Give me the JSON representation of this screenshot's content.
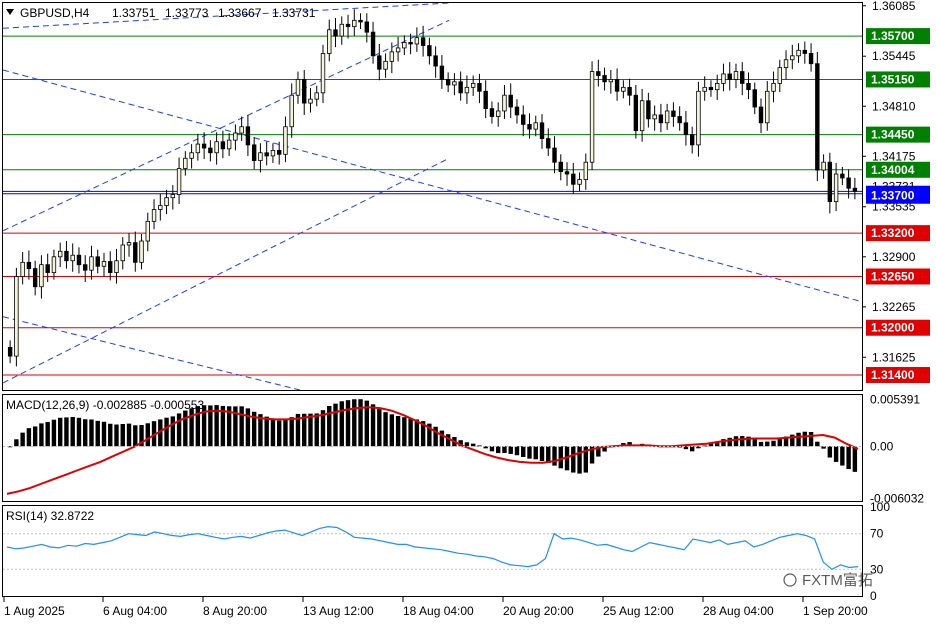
{
  "header": {
    "symbol": "GBPUSD,H4",
    "ohlc": [
      "1.33751",
      "1.33773",
      "1.33667",
      "1.33731"
    ],
    "collapse_icon": "triangle-down-icon"
  },
  "colors": {
    "background": "#ffffff",
    "bull_candle": "#f5f5dc",
    "bear_candle": "#000000",
    "green_line": "#008000",
    "red_line": "#e00000",
    "blue_line": "#0000ff",
    "channel": "#1e3cff",
    "macd_signal": "#e00000",
    "rsi_line": "#1e90ff",
    "green_tag": "#008000",
    "red_tag": "#e00000",
    "blue_tag": "#0000ff"
  },
  "chart_data": [
    {
      "type": "candlestick",
      "title": "GBPUSD,H4",
      "y_axis_labels": [
        "1.36085",
        "1.35445",
        "1.34810",
        "1.34175",
        "1.33535",
        "1.32900",
        "1.32265",
        "1.31625"
      ],
      "ylim": [
        1.3121,
        1.3612
      ],
      "x_tick_labels": [
        "1 Aug 2025",
        "6 Aug 04:00",
        "8 Aug 20:00",
        "13 Aug 12:00",
        "18 Aug 04:00",
        "20 Aug 20:00",
        "25 Aug 12:00",
        "28 Aug 04:00",
        "1 Sep 20:00"
      ],
      "levels": [
        {
          "value": 1.357,
          "label": "1.35700",
          "kind": "resistance"
        },
        {
          "value": 1.3515,
          "label": "1.35150",
          "kind": "resistance"
        },
        {
          "value": 1.3445,
          "label": "1.34450",
          "kind": "resistance"
        },
        {
          "value": 1.34004,
          "label": "1.34004",
          "kind": "resistance"
        },
        {
          "value": 1.337,
          "label": "1.33700",
          "kind": "current"
        },
        {
          "value": 1.332,
          "label": "1.33200",
          "kind": "support"
        },
        {
          "value": 1.3265,
          "label": "1.32650",
          "kind": "support"
        },
        {
          "value": 1.32,
          "label": "1.32000",
          "kind": "support"
        },
        {
          "value": 1.314,
          "label": "1.31400",
          "kind": "support"
        }
      ],
      "hidden_price_label": "1.33731",
      "candle_closes": [
        1.3164,
        1.3265,
        1.3283,
        1.3275,
        1.3252,
        1.328,
        1.327,
        1.329,
        1.3297,
        1.3285,
        1.3292,
        1.328,
        1.3273,
        1.329,
        1.3278,
        1.3284,
        1.327,
        1.3285,
        1.3305,
        1.3308,
        1.3283,
        1.331,
        1.3335,
        1.335,
        1.3355,
        1.3365,
        1.3369,
        1.3402,
        1.3415,
        1.3422,
        1.3433,
        1.3428,
        1.3422,
        1.3436,
        1.3427,
        1.3438,
        1.3447,
        1.3455,
        1.3432,
        1.3412,
        1.3422,
        1.3418,
        1.3425,
        1.342,
        1.3455,
        1.3495,
        1.3515,
        1.3485,
        1.349,
        1.3498,
        1.3548,
        1.3578,
        1.357,
        1.3585,
        1.3582,
        1.359,
        1.3588,
        1.3575,
        1.3545,
        1.3528,
        1.3538,
        1.355,
        1.3555,
        1.3562,
        1.356,
        1.3568,
        1.3558,
        1.3545,
        1.3532,
        1.3515,
        1.3508,
        1.3512,
        1.3498,
        1.3505,
        1.351,
        1.35,
        1.3478,
        1.3468,
        1.3475,
        1.3495,
        1.348,
        1.347,
        1.3458,
        1.3452,
        1.346,
        1.344,
        1.3428,
        1.341,
        1.3398,
        1.3395,
        1.3382,
        1.3388,
        1.341,
        1.3525,
        1.352,
        1.3512,
        1.3515,
        1.35,
        1.3505,
        1.3495,
        1.345,
        1.3488,
        1.3465,
        1.347,
        1.346,
        1.3475,
        1.3468,
        1.346,
        1.3445,
        1.3432,
        1.35,
        1.3505,
        1.3502,
        1.351,
        1.3522,
        1.3515,
        1.3525,
        1.351,
        1.3502,
        1.348,
        1.346,
        1.35,
        1.351,
        1.353,
        1.354,
        1.3545,
        1.3552,
        1.3548,
        1.3535,
        1.34,
        1.341,
        1.336,
        1.3395,
        1.339,
        1.3377,
        1.3373
      ],
      "macd": {
        "label": "MACD(12,26,9) -0.002885 -0.000553",
        "y_axis_labels": [
          "0.005391",
          "0.00",
          "-0.006032"
        ],
        "ylim": [
          -0.0062,
          0.0058
        ],
        "signal": [
          -0.0055,
          -0.0052,
          -0.0048,
          -0.0043,
          -0.0038,
          -0.0033,
          -0.0028,
          -0.0023,
          -0.0018,
          -0.0012,
          -0.0006,
          0.0,
          0.0008,
          0.0016,
          0.0024,
          0.0031,
          0.0036,
          0.004,
          0.0041,
          0.004,
          0.0037,
          0.0034,
          0.0032,
          0.0031,
          0.0031,
          0.0032,
          0.0034,
          0.0036,
          0.0039,
          0.0042,
          0.0044,
          0.0045,
          0.0044,
          0.0041,
          0.0036,
          0.003,
          0.0023,
          0.0015,
          0.0008,
          0.0001,
          -0.0004,
          -0.0009,
          -0.0013,
          -0.0016,
          -0.0018,
          -0.0019,
          -0.0019,
          -0.0017,
          -0.0013,
          -0.0008,
          -0.0004,
          -0.0001,
          0.0,
          0.0001,
          0.0001,
          0.0001,
          0.0,
          0.0,
          0.0001,
          0.0002,
          0.0003,
          0.0005,
          0.0007,
          0.0008,
          0.0009,
          0.0009,
          0.0009,
          0.001,
          0.0011,
          0.0012,
          0.0013,
          0.001,
          0.0003,
          -0.0003
        ]
      },
      "rsi": {
        "label": "RSI(14) 32.8722",
        "y_axis_labels": [
          "100",
          "70",
          "30",
          "0"
        ],
        "ylim": [
          0,
          100
        ],
        "levels": [
          70,
          30
        ],
        "values": [
          55,
          53,
          54,
          56,
          58,
          55,
          54,
          57,
          56,
          59,
          58,
          60,
          62,
          66,
          70,
          69,
          68,
          72,
          70,
          68,
          67,
          69,
          70,
          68,
          66,
          64,
          66,
          67,
          65,
          68,
          71,
          73,
          74,
          71,
          68,
          72,
          76,
          78,
          77,
          72,
          66,
          65,
          64,
          62,
          60,
          58,
          58,
          55,
          54,
          53,
          52,
          50,
          48,
          47,
          45,
          44,
          42,
          38,
          35,
          34,
          33,
          35,
          42,
          70,
          64,
          65,
          63,
          60,
          57,
          58,
          55,
          52,
          50,
          55,
          60,
          58,
          56,
          54,
          52,
          64,
          62,
          60,
          63,
          58,
          60,
          62,
          55,
          58,
          62,
          66,
          68,
          70,
          68,
          64,
          38,
          30,
          35,
          32,
          33
        ]
      }
    }
  ],
  "watermark": {
    "text": "FXTM富拓"
  }
}
